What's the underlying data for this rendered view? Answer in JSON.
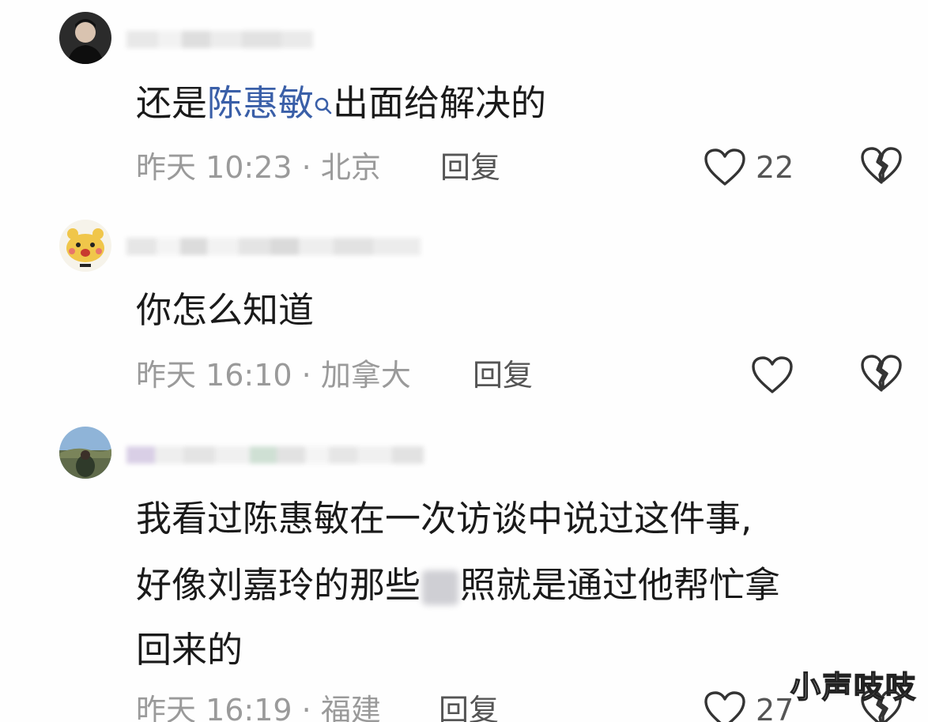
{
  "comments": [
    {
      "text_before": "还是",
      "link_text": "陈惠敏",
      "text_after": "出面给解决的",
      "meta": "昨天 10:23 · 北京",
      "reply_label": "回复",
      "like_count": "22"
    },
    {
      "text": "你怎么知道",
      "meta": "昨天 16:10 · 加拿大",
      "reply_label": "回复",
      "like_count": ""
    },
    {
      "line1": "我看过陈惠敏在一次访谈中说过这件事,",
      "line2_before": "好像刘嘉玲的那些",
      "line2_after": "照就是通过他帮忙拿",
      "line3": "回来的",
      "meta": "昨天 16:19 · 福建",
      "reply_label": "回复",
      "like_count": "27"
    }
  ],
  "watermark": "小声吱吱",
  "colors": {
    "link": "#3a5fa8",
    "meta": "#9a9a9a",
    "text": "#1a1a1a"
  },
  "icons": [
    "search-icon",
    "heart-icon",
    "broken-heart-icon"
  ]
}
